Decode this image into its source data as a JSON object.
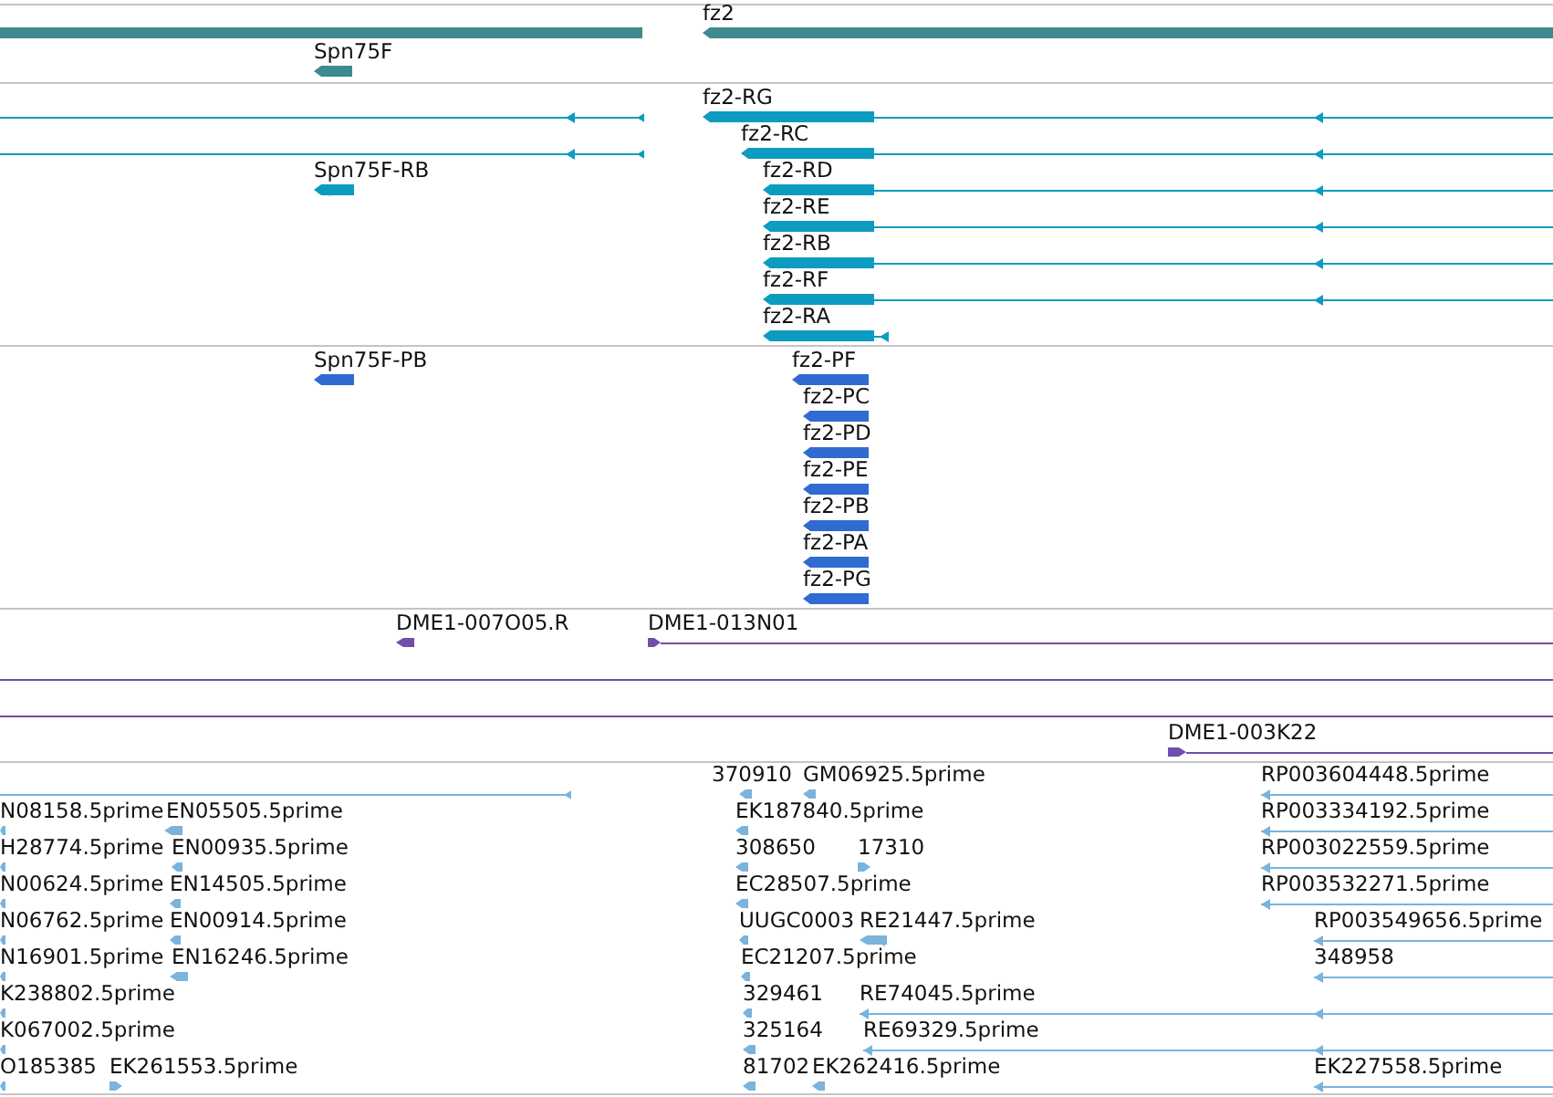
{
  "tracks": [
    {
      "color": "#3d8b8e",
      "features": [
        {
          "kind": "bar"
        },
        {
          "label": "fz2",
          "reverse": true
        },
        {
          "label": "Spn75F",
          "reverse": true
        }
      ]
    },
    {
      "color": "#0e9bc0",
      "features": [
        {
          "reverse": true
        },
        {
          "reverse": true
        },
        {
          "label": "fz2-RG",
          "reverse": true
        },
        {
          "label": "fz2-RC",
          "reverse": true
        },
        {
          "label": "Spn75F-RB",
          "reverse": true
        },
        {
          "label": "fz2-RD",
          "reverse": true
        },
        {
          "label": "fz2-RE",
          "reverse": true
        },
        {
          "label": "fz2-RB",
          "reverse": true
        },
        {
          "label": "fz2-RF",
          "reverse": true
        },
        {
          "label": "fz2-RA",
          "reverse": true
        }
      ]
    },
    {
      "color": "#2f6bd0",
      "features": [
        {
          "label": "Spn75F-PB",
          "reverse": true
        },
        {
          "label": "fz2-PF",
          "reverse": true
        },
        {
          "label": "fz2-PC",
          "reverse": true
        },
        {
          "label": "fz2-PD",
          "reverse": true
        },
        {
          "label": "fz2-PE",
          "reverse": true
        },
        {
          "label": "fz2-PB",
          "reverse": true
        },
        {
          "label": "fz2-PA",
          "reverse": true
        },
        {
          "label": "fz2-PG",
          "reverse": true
        }
      ]
    },
    {
      "color": "#6f4fa8",
      "features": [
        {
          "label": "DME1-007O05.R",
          "reverse": true
        },
        {
          "label": "DME1-013N01",
          "reverse": false
        },
        {
          "kind": "line"
        },
        {
          "kind": "line"
        },
        {
          "label": "DME1-003K22",
          "reverse": false
        }
      ]
    },
    {
      "color": "#7ab3dc",
      "features": [
        {
          "reverse": true
        },
        {
          "label": "370910",
          "reverse": true
        },
        {
          "label": "GM06925.5prime",
          "reverse": true
        },
        {
          "label": "RP003604448.5prime",
          "reverse": true
        },
        {
          "label": "N08158.5prime",
          "reverse": true
        },
        {
          "label": "EN05505.5prime",
          "reverse": true
        },
        {
          "label": "EK187840.5prime",
          "reverse": true
        },
        {
          "label": "RP003334192.5prime",
          "reverse": true
        },
        {
          "label": "H28774.5prime",
          "reverse": true
        },
        {
          "label": "EN00935.5prime",
          "reverse": true
        },
        {
          "label": "308650",
          "reverse": true
        },
        {
          "label": "17310",
          "reverse": false
        },
        {
          "label": "RP003022559.5prime",
          "reverse": true
        },
        {
          "label": "N00624.5prime",
          "reverse": true
        },
        {
          "label": "EN14505.5prime",
          "reverse": true
        },
        {
          "label": "EC28507.5prime",
          "reverse": true
        },
        {
          "label": "RP003532271.5prime",
          "reverse": true
        },
        {
          "label": "N06762.5prime",
          "reverse": true
        },
        {
          "label": "EN00914.5prime",
          "reverse": true
        },
        {
          "label": "UUGC0003",
          "reverse": true
        },
        {
          "label": "RE21447.5prime",
          "reverse": true
        },
        {
          "label": "RP003549656.5prime",
          "reverse": true
        },
        {
          "label": "N16901.5prime",
          "reverse": true
        },
        {
          "label": "EN16246.5prime",
          "reverse": true
        },
        {
          "label": "EC21207.5prime",
          "reverse": true
        },
        {
          "label": "348958",
          "reverse": true
        },
        {
          "label": "K238802.5prime",
          "reverse": true
        },
        {
          "label": "329461",
          "reverse": true
        },
        {
          "label": "RE74045.5prime",
          "reverse": true
        },
        {
          "label": "K067002.5prime",
          "reverse": true
        },
        {
          "label": "325164",
          "reverse": true
        },
        {
          "label": "RE69329.5prime",
          "reverse": true
        },
        {
          "label": "O185385",
          "reverse": true
        },
        {
          "label": "EK261553.5prime",
          "reverse": false
        },
        {
          "label": "81702",
          "reverse": true
        },
        {
          "label": "EK262416.5prime",
          "reverse": true
        },
        {
          "label": "EK227558.5prime",
          "reverse": true
        }
      ]
    }
  ]
}
